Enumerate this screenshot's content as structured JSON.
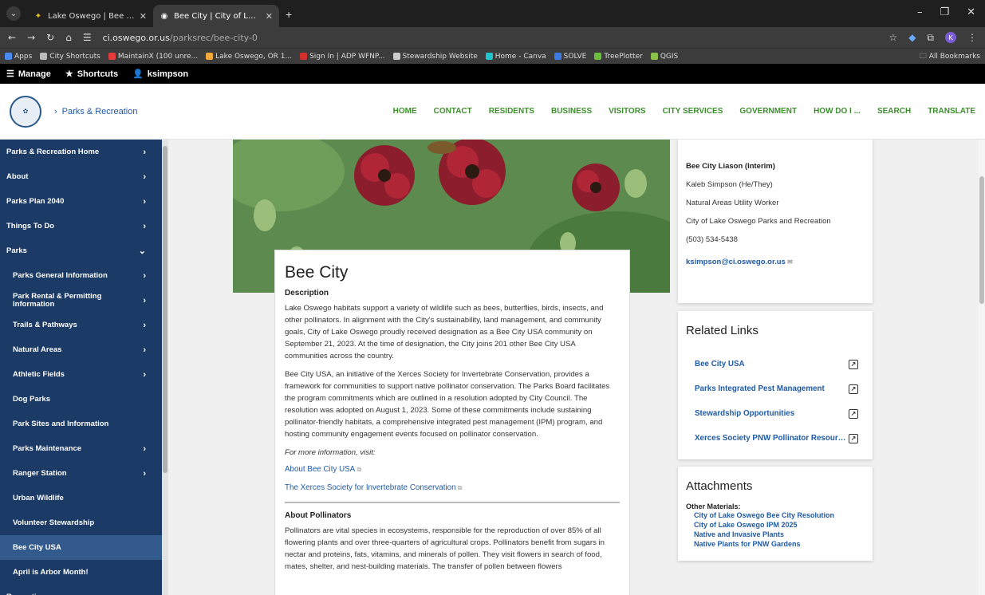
{
  "browser": {
    "tabs": [
      {
        "title": "Lake Oswego | Bee City USA",
        "active": false
      },
      {
        "title": "Bee City | City of Lake Oswego",
        "active": true
      }
    ],
    "url_host": "ci.oswego.or.us",
    "url_path": "/parksrec/bee-city-0",
    "bookmarks": [
      {
        "label": "Apps",
        "color": "#4a8af4"
      },
      {
        "label": "City Shortcuts",
        "color": "#bbbbbb"
      },
      {
        "label": "MaintainX (100 unre...",
        "color": "#e43b3b"
      },
      {
        "label": "Lake Oswego, OR 1...",
        "color": "#f2a93b"
      },
      {
        "label": "Sign In | ADP WFNP...",
        "color": "#d32f2f"
      },
      {
        "label": "Stewardship Website",
        "color": "#cccccc"
      },
      {
        "label": "Home - Canva",
        "color": "#20c4cb"
      },
      {
        "label": "SOLVE",
        "color": "#3b7be4"
      },
      {
        "label": "TreePlotter",
        "color": "#6abf3b"
      },
      {
        "label": "QGIS",
        "color": "#8bc34a"
      }
    ],
    "all_bookmarks": "All Bookmarks"
  },
  "adminbar": {
    "manage": "Manage",
    "shortcuts": "Shortcuts",
    "user": "ksimpson"
  },
  "header": {
    "breadcrumb": "Parks & Recreation",
    "nav": [
      "HOME",
      "CONTACT",
      "RESIDENTS",
      "BUSINESS",
      "VISITORS",
      "CITY SERVICES",
      "GOVERNMENT",
      "HOW DO I ...",
      "SEARCH",
      "TRANSLATE"
    ]
  },
  "sidebar": [
    {
      "label": "Parks & Recreation Home",
      "chev": "›",
      "sub": false,
      "current": false
    },
    {
      "label": "About",
      "chev": "›",
      "sub": false,
      "current": false
    },
    {
      "label": "Parks Plan 2040",
      "chev": "›",
      "sub": false,
      "current": false
    },
    {
      "label": "Things To Do",
      "chev": "›",
      "sub": false,
      "current": false
    },
    {
      "label": "Parks",
      "chev": "⌄",
      "sub": false,
      "current": false
    },
    {
      "label": "Parks General Information",
      "chev": "›",
      "sub": true,
      "current": false
    },
    {
      "label": "Park Rental & Permitting Information",
      "chev": "›",
      "sub": true,
      "current": false
    },
    {
      "label": "Trails & Pathways",
      "chev": "›",
      "sub": true,
      "current": false
    },
    {
      "label": "Natural Areas",
      "chev": "›",
      "sub": true,
      "current": false
    },
    {
      "label": "Athletic Fields",
      "chev": "›",
      "sub": true,
      "current": false
    },
    {
      "label": "Dog Parks",
      "chev": "",
      "sub": true,
      "current": false
    },
    {
      "label": "Park Sites and Information",
      "chev": "",
      "sub": true,
      "current": false
    },
    {
      "label": "Parks Maintenance",
      "chev": "›",
      "sub": true,
      "current": false
    },
    {
      "label": "Ranger Station",
      "chev": "›",
      "sub": true,
      "current": false
    },
    {
      "label": "Urban Wildlife",
      "chev": "",
      "sub": true,
      "current": false
    },
    {
      "label": "Volunteer Stewardship",
      "chev": "",
      "sub": true,
      "current": false
    },
    {
      "label": "Bee City USA",
      "chev": "",
      "sub": true,
      "current": true
    },
    {
      "label": "April is Arbor Month!",
      "chev": "",
      "sub": true,
      "current": false
    },
    {
      "label": "Recreation",
      "chev": "›",
      "sub": false,
      "current": false
    }
  ],
  "content": {
    "title": "Bee City",
    "description_heading": "Description",
    "para1": "Lake Oswego habitats support a variety of wildlife such as bees, butterflies, birds, insects, and other pollinators. In alignment with the City's sustainability, land management, and community goals, City of Lake Oswego proudly received designation as a Bee City USA community on September 21, 2023. At the time of designation, the City joins 201 other Bee City USA communities across the country.",
    "para2": "Bee City USA, an initiative of the Xerces Society for Invertebrate Conservation, provides a framework for communities to support native pollinator conservation. The Parks Board facilitates the program commitments which are outlined in a resolution adopted by City Council. The resolution was adopted on August 1, 2023. Some of these commitments include sustaining pollinator-friendly habitats, a comprehensive integrated pest management (IPM) program, and hosting community engagement events focused on pollinator conservation.",
    "more_info": "For more information, visit:",
    "link1": "About Bee City USA",
    "link2": "The Xerces Society for Invertebrate Conservation",
    "pollinators_heading": "About Pollinators",
    "para3": "Pollinators are vital species in ecosystems, responsible for the reproduction of over 85% of all flowering plants and over three-quarters of agricultural crops. Pollinators benefit from sugars in nectar and proteins, fats, vitamins, and minerals of pollen. They visit flowers in search of food, mates, shelter, and nest-building materials. The transfer of pollen between flowers"
  },
  "contact": {
    "title": "Bee City Liason (Interim)",
    "name": "Kaleb Simpson (He/They)",
    "role": "Natural Areas Utility Worker",
    "org": "City of Lake Oswego Parks and Recreation",
    "phone": "(503) 534-5438",
    "email": "ksimpson@ci.oswego.or.us"
  },
  "related": {
    "heading": "Related Links",
    "links": [
      "Bee City USA",
      "Parks Integrated Pest Management",
      "Stewardship Opportunities",
      "Xerces Society PNW Pollinator Resources"
    ]
  },
  "attachments": {
    "heading": "Attachments",
    "group": "Other Materials:",
    "links": [
      "City of Lake Oswego Bee City Resolution",
      "City of Lake Oswego IPM 2025",
      "Native and Invasive Plants",
      "Native Plants for PNW Gardens"
    ]
  }
}
